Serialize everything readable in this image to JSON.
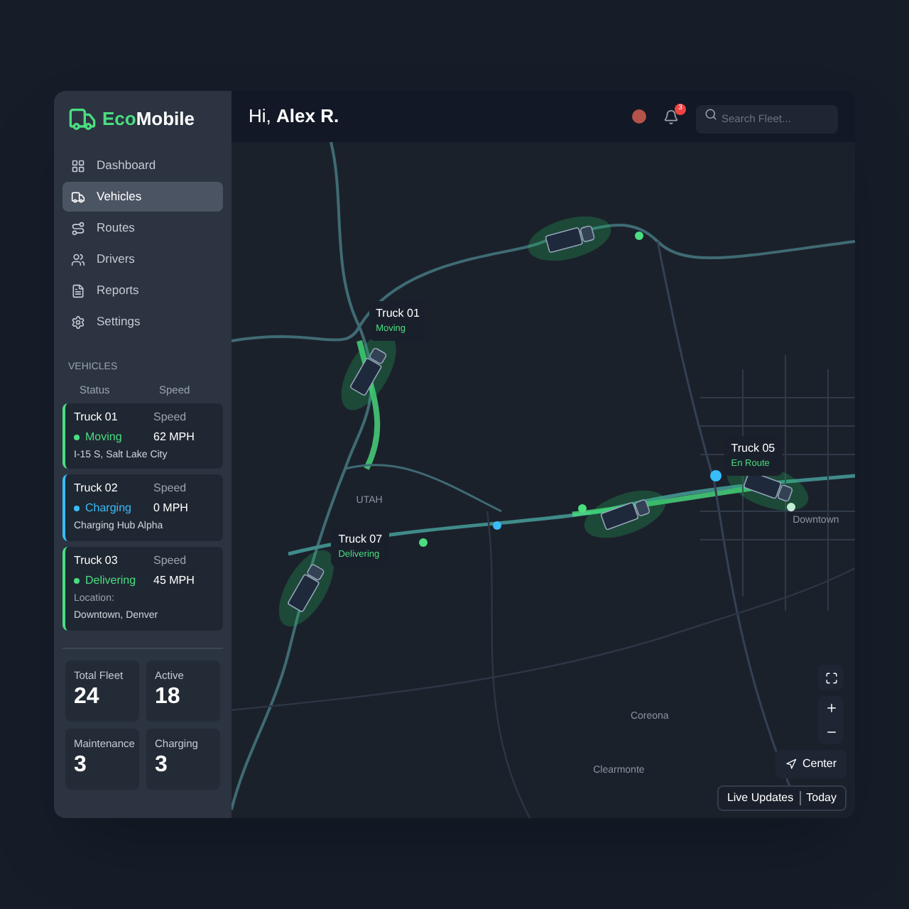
{
  "brand": {
    "prefix": "Eco",
    "suffix": "Mobile"
  },
  "nav": [
    {
      "label": "Dashboard",
      "selected": false
    },
    {
      "label": "Vehicles",
      "selected": true
    },
    {
      "label": "Routes",
      "selected": false
    },
    {
      "label": "Drivers",
      "selected": false
    },
    {
      "label": "Reports",
      "selected": false
    },
    {
      "label": "Settings",
      "selected": false
    }
  ],
  "vehicles_section": {
    "title": "VEHICLES",
    "columns": [
      "Status",
      "Speed"
    ],
    "items": [
      {
        "name": "Truck 01",
        "status": "Moving",
        "color": "#4ade80",
        "speed_label": "Speed",
        "speed": "62 MPH",
        "location": "I-15 S, Salt Lake City"
      },
      {
        "name": "Truck 02",
        "status": "Charging",
        "color": "#38bdf8",
        "speed_label": "Speed",
        "speed": "0 MPH",
        "location": "Charging Hub Alpha"
      },
      {
        "name": "Truck 03",
        "status": "Delivering",
        "color": "#4ade80",
        "speed_label": "Speed",
        "speed": "45 MPH",
        "location_label": "Location:",
        "location": "Downtown, Denver"
      }
    ]
  },
  "stats": [
    {
      "label": "Total Fleet",
      "value": "24"
    },
    {
      "label": "Active",
      "value": "18"
    },
    {
      "label": "Maintenance",
      "value": "3"
    },
    {
      "label": "Charging",
      "value": "3"
    }
  ],
  "header": {
    "greeting": "Hi,",
    "user": "Alex R.",
    "notifications": "3",
    "search": {
      "placeholder": "Search Fleet..."
    }
  },
  "map": {
    "places": [
      "UTAH",
      "Downtown",
      "Coreona",
      "Clearmonte"
    ],
    "trucks": [
      {
        "name": "Truck 01",
        "status": "Moving"
      },
      {
        "name": "Truck 07",
        "status": "Delivering"
      },
      {
        "name": "Truck 05",
        "status": "En Route"
      }
    ],
    "center_button": "Center",
    "live_updates": "Live Updates",
    "period": "Today"
  }
}
